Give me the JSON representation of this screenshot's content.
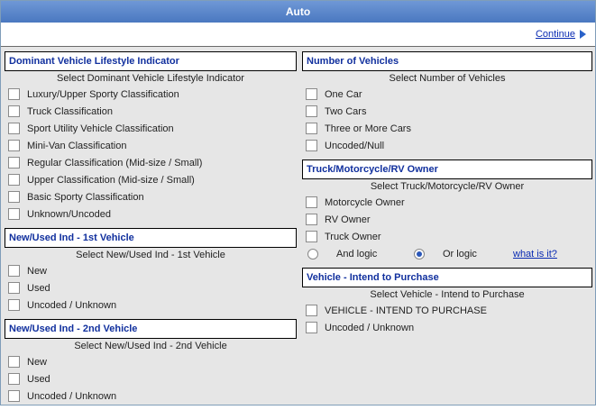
{
  "window": {
    "title": "Auto"
  },
  "topbar": {
    "continue_label": "Continue"
  },
  "left": [
    {
      "title": "Dominant Vehicle Lifestyle Indicator",
      "subtitle": "Select Dominant Vehicle Lifestyle Indicator",
      "options": [
        "Luxury/Upper Sporty Classification",
        "Truck Classification",
        "Sport Utility Vehicle Classification",
        "Mini-Van Classification",
        "Regular Classification (Mid-size / Small)",
        "Upper Classification (Mid-size / Small)",
        "Basic Sporty Classification",
        "Unknown/Uncoded"
      ]
    },
    {
      "title": "New/Used Ind - 1st Vehicle",
      "subtitle": "Select New/Used Ind - 1st Vehicle",
      "options": [
        "New",
        "Used",
        "Uncoded / Unknown"
      ]
    },
    {
      "title": "New/Used Ind - 2nd Vehicle",
      "subtitle": "Select New/Used Ind - 2nd Vehicle",
      "options": [
        "New",
        "Used",
        "Uncoded / Unknown"
      ]
    }
  ],
  "right": [
    {
      "title": "Number of Vehicles",
      "subtitle": "Select Number of Vehicles",
      "options": [
        "One Car",
        "Two Cars",
        "Three or More Cars",
        "Uncoded/Null"
      ]
    },
    {
      "title": "Truck/Motorcycle/RV Owner",
      "subtitle": "Select Truck/Motorcycle/RV Owner",
      "options": [
        "Motorcycle Owner",
        "RV Owner",
        "Truck Owner"
      ]
    },
    {
      "title": "Vehicle - Intend to Purchase",
      "subtitle": "Select Vehicle - Intend to Purchase",
      "options": [
        "VEHICLE - INTEND TO PURCHASE",
        "Uncoded / Unknown"
      ]
    }
  ],
  "logic": {
    "and_label": "And logic",
    "or_label": "Or logic",
    "help_label": "what is it?",
    "selected": "or"
  }
}
